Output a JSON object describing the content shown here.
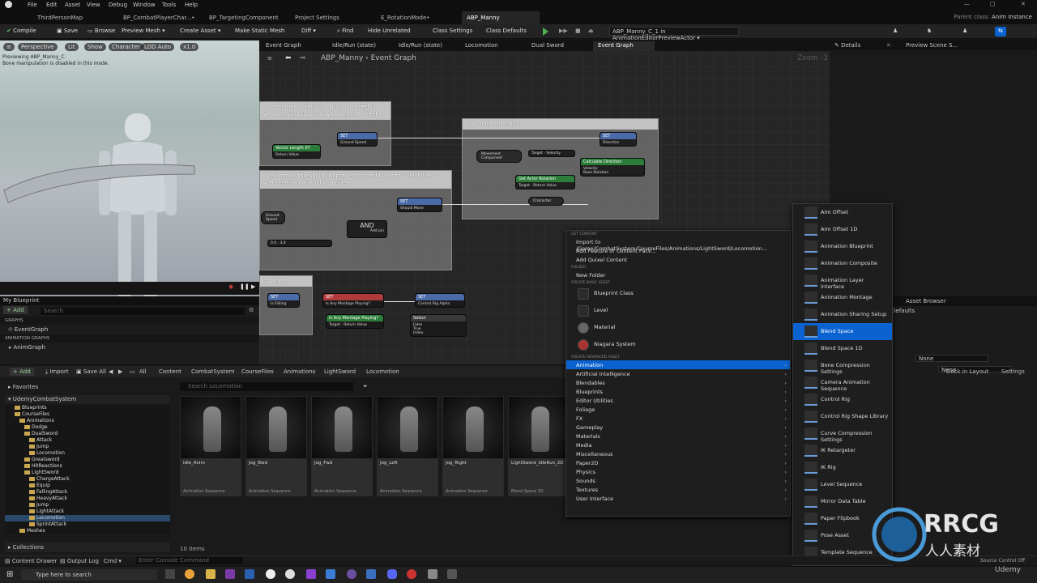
{
  "menu": {
    "items": [
      "File",
      "Edit",
      "Asset",
      "View",
      "Debug",
      "Window",
      "Tools",
      "Help"
    ]
  },
  "doc_tabs": [
    "ThirdPersonMap",
    "BP_CombatPlayerChar...•",
    "BP_TargetingComponent",
    "Project Settings",
    "E_RotationMode•",
    "ABP_Manny"
  ],
  "parent_class": {
    "label": "Parent class:",
    "value": "Anim Instance"
  },
  "toolbar": {
    "compile": "Compile",
    "save": "Save",
    "browse": "Browse",
    "preview_mesh": "Preview Mesh ▾",
    "create_asset": "Create Asset ▾",
    "make_static_mesh": "Make Static Mesh",
    "diff": "Diff ▾",
    "find": "Find",
    "hide_unrelated": "Hide Unrelated",
    "class_settings": "Class Settings",
    "class_defaults": "Class Defaults",
    "debug_filter": "ABP_Manny_C_1 in AnimationEditorPreviewActor ▾"
  },
  "viewport": {
    "buttons": [
      "Perspective",
      "Lit",
      "Show",
      "Character",
      "LOD Auto",
      "x1.0"
    ],
    "overlay_lines": [
      "Previewing ABP_Manny_C.",
      "Bone manipulation is disabled in this mode."
    ]
  },
  "my_blueprint": {
    "title": "My Blueprint",
    "add": "+ Add",
    "search_placeholder": "Search",
    "sections": [
      {
        "name": "GRAPHS",
        "item": "EventGraph"
      },
      {
        "name": "ANIMATION GRAPHS",
        "item": "AnimGraph"
      }
    ]
  },
  "graph": {
    "tabs": [
      "Event Graph",
      "Idle/Run (state)",
      "Idle/Run (state)",
      "Locomotion",
      "Dual Sword",
      "Event Graph"
    ],
    "breadcrumb_root": "ABP_Manny",
    "breadcrumb_leaf": "Event Graph",
    "zoom": "Zoom -3",
    "comments": [
      "t components velocity. Ground speed is\ny, so moving up or down does not affect",
      "Calculate Direction",
      "ove a small threshold (to prevent incredibly small velocities\ny acceleration (input)) applied",
      "ng state"
    ],
    "nodes": {
      "set1": "SET",
      "ground_speed": "Ground Speed",
      "vector_length": "Vector Length XY",
      "return_value": "Return Value",
      "set2": "SET",
      "direction": "Direction",
      "movement_component": "Movement Component",
      "target": "Target",
      "velocity": "Velocity",
      "calc_direction": "Calculate Direction",
      "get_actor_rotation": "Get Actor Rotation",
      "base_rotation": "Base Rotation",
      "character": "Character",
      "and": "AND",
      "add_pin": "Add pin",
      "set3": "SET",
      "should_move": "Should Move",
      "is_falling": "Is Falling",
      "is_any_montage": "Is Any Montage Playing?",
      "control_rig_alpha": "Control Rig Alpha",
      "select": "Select",
      "false": "False",
      "true": "True",
      "index": "Index",
      "v1": "0.0",
      "v2": "3.0"
    }
  },
  "details": {
    "title": "Details",
    "preview_tab": "Preview Scene S..."
  },
  "bottom_right": {
    "asset_browser": "Asset Browser",
    "defaults": "Defaults",
    "none1": "None",
    "none2": "None",
    "dock_in_layout": "Dock in Layout",
    "settings": "Settings"
  },
  "content_browser": {
    "add": "+ Add",
    "import": "Import",
    "save_all": "Save All",
    "path": [
      "All",
      "Content",
      "CombatSystem",
      "CourseFiles",
      "Animations",
      "LightSword",
      "Locomotion"
    ],
    "favorites": "Favorites",
    "root": "UdemyCombatSystem",
    "search_placeholder": "Search Locomotion",
    "tree": [
      {
        "label": "Blueprints",
        "depth": 1
      },
      {
        "label": "CourseFiles",
        "depth": 1
      },
      {
        "label": "Animations",
        "depth": 2
      },
      {
        "label": "Dodge",
        "depth": 3
      },
      {
        "label": "DualSword",
        "depth": 3
      },
      {
        "label": "Attack",
        "depth": 4
      },
      {
        "label": "Jump",
        "depth": 4
      },
      {
        "label": "Locomotion",
        "depth": 4
      },
      {
        "label": "Greatsword",
        "depth": 3
      },
      {
        "label": "HitReactions",
        "depth": 3
      },
      {
        "label": "LightSword",
        "depth": 3
      },
      {
        "label": "ChargeAttack",
        "depth": 4
      },
      {
        "label": "Equip",
        "depth": 4
      },
      {
        "label": "FallingAttack",
        "depth": 4
      },
      {
        "label": "HeavyAttack",
        "depth": 4
      },
      {
        "label": "Jump",
        "depth": 4
      },
      {
        "label": "LightAttack",
        "depth": 4
      },
      {
        "label": "Locomotion",
        "depth": 4
      },
      {
        "label": "SprintAttack",
        "depth": 4
      },
      {
        "label": "Meshes",
        "depth": 2
      }
    ],
    "assets": [
      {
        "name": "Idle_Anim",
        "type": "Animation Sequence"
      },
      {
        "name": "Jog_Bwd",
        "type": "Animation Sequence"
      },
      {
        "name": "Jog_Fwd",
        "type": "Animation Sequence"
      },
      {
        "name": "Jog_Left",
        "type": "Animation Sequence"
      },
      {
        "name": "Jog_Right",
        "type": "Animation Sequence"
      },
      {
        "name": "LightSword_IdleRun_2D",
        "type": "Blend Space 1D"
      }
    ],
    "count": "10 items",
    "collections": "Collections"
  },
  "context_menu": {
    "get_content_header": "GET CONTENT",
    "get_content": [
      "Import to /Game/CombatSystem/CourseFiles/Animations/LightSword/Locomotion...",
      "Add Feature or Content Pack...",
      "Add Quixel Content"
    ],
    "folder_header": "FOLDER",
    "new_folder": "New Folder",
    "basic_header": "CREATE BASIC ASSET",
    "basic": [
      "Blueprint Class",
      "Level",
      "Material",
      "Niagara System"
    ],
    "advanced_header": "CREATE ADVANCED ASSET",
    "advanced": [
      "Animation",
      "Artificial Intelligence",
      "Blendables",
      "Blueprints",
      "Editor Utilities",
      "Foliage",
      "FX",
      "Gameplay",
      "Materials",
      "Media",
      "Miscellaneous",
      "Paper2D",
      "Physics",
      "Sounds",
      "Textures",
      "User Interface"
    ]
  },
  "submenu": {
    "items": [
      "Aim Offset",
      "Aim Offset 1D",
      "Animation Blueprint",
      "Animation Composite",
      "Animation Layer Interface",
      "Animation Montage",
      "Animation Sharing Setup",
      "Blend Space",
      "Blend Space 1D",
      "Bone Compression Settings",
      "Camera Animation Sequence",
      "Control Rig",
      "Control Rig Shape Library",
      "Curve Compression Settings",
      "IK Retargeter",
      "IK Rig",
      "Level Sequence",
      "Mirror Data Table",
      "Paper Flipbook",
      "Pose Asset",
      "Template Sequence"
    ],
    "highlighted": "Blend Space"
  },
  "statusbar": {
    "content_drawer": "Content Drawer",
    "output_log": "Output Log",
    "cmd": "Cmd ▾",
    "console_placeholder": "Enter Console Command",
    "source_control": "Source Control Off"
  },
  "taskbar": {
    "search_placeholder": "Type here to search"
  },
  "watermark": {
    "brand": "RRCG",
    "sub": "人人素材",
    "udemy": "Udemy"
  }
}
